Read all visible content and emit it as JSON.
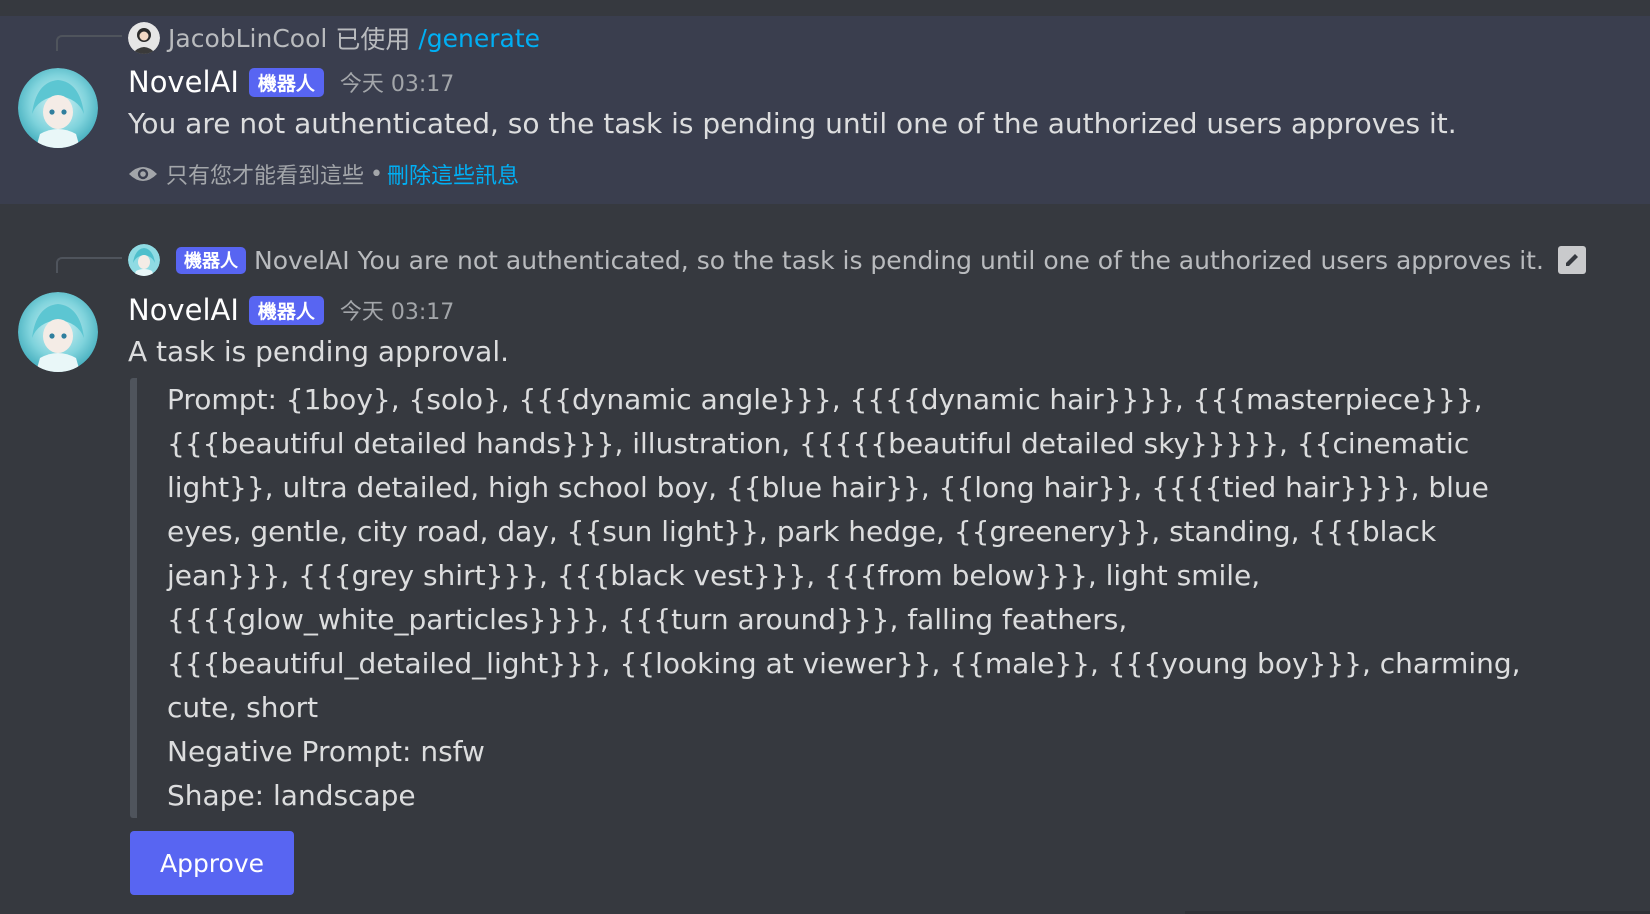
{
  "message1": {
    "reply": {
      "user": "JacobLinCool",
      "action": "已使用",
      "command": "/generate"
    },
    "author": "NovelAI",
    "bot_tag": "機器人",
    "timestamp": "今天 03:17",
    "text": "You are not authenticated, so the task is pending until one of the authorized users approves it.",
    "ephemeral": {
      "notice": "只有您才能看到這些",
      "separator": "•",
      "dismiss_label": "刪除這些訊息"
    }
  },
  "message2": {
    "reply": {
      "bot_tag": "機器人",
      "user": "NovelAI",
      "text": "You are not authenticated, so the task is pending until one of the authorized users approves it."
    },
    "author": "NovelAI",
    "bot_tag": "機器人",
    "timestamp": "今天 03:17",
    "text": "A task is pending approval.",
    "embed_lines": [
      "Prompt: {1boy}, {solo}, {{{dynamic angle}}}, {{{{dynamic hair}}}}, {{{masterpiece}}},",
      "{{{beautiful detailed hands}}}, illustration, {{{{{beautiful detailed sky}}}}},  {{cinematic",
      "light}}, ultra detailed, high school boy, {{blue hair}}, {{long hair}}, {{{{tied hair}}}}, blue",
      "eyes, gentle, city road, day, {{sun light}}, park hedge, {{greenery}}, standing, {{{black",
      "jean}}}, {{{grey shirt}}}, {{{black vest}}}, {{{from below}}}, light smile,",
      "{{{{glow_white_particles}}}}, {{{turn around}}}, falling feathers,",
      "{{{beautiful_detailed_light}}}, {{looking at viewer}}, {{male}}, {{{young boy}}}, charming,",
      "cute, short",
      "Negative Prompt: nsfw",
      "Shape: landscape"
    ],
    "approve_label": "Approve"
  },
  "colors": {
    "background": "#36393f",
    "highlight_background": "#3a3e4e",
    "blurple": "#5865f2",
    "link": "#00aff4",
    "muted_text": "#a3a6aa"
  },
  "icons": [
    "avatar-novelai",
    "avatar-jacoblincool",
    "eye-icon",
    "edit-icon"
  ]
}
